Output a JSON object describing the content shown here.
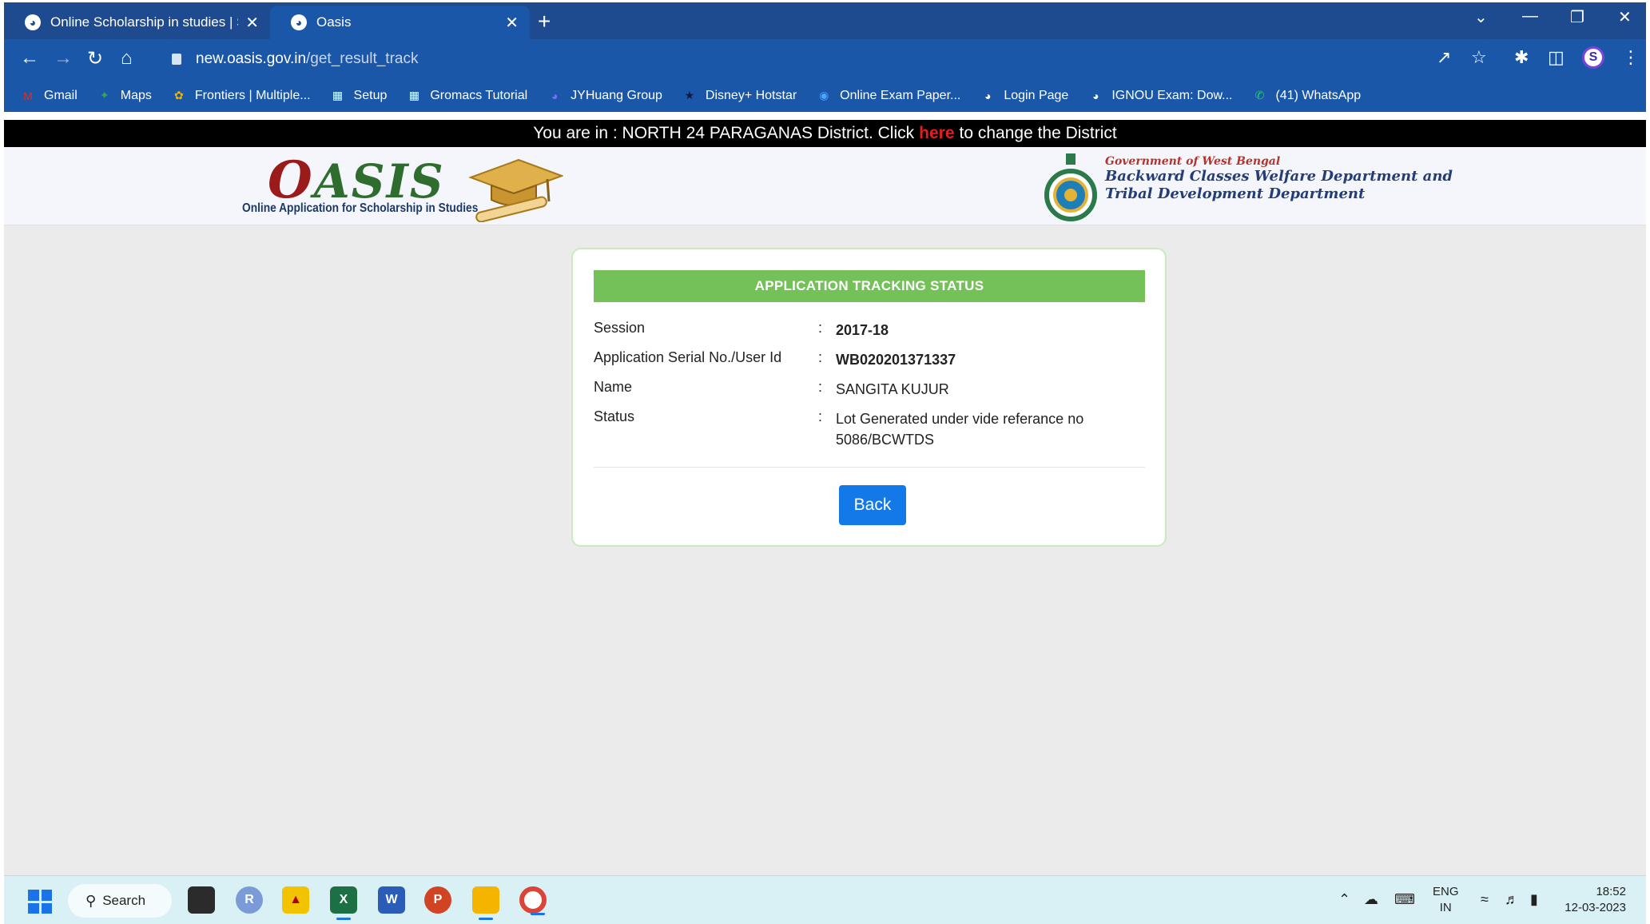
{
  "browser": {
    "tabs": [
      {
        "title": "Online Scholarship in studies | Sc"
      },
      {
        "title": "Oasis"
      }
    ],
    "url_host": "new.oasis.gov.in",
    "url_path": "/get_result_track",
    "bookmarks": [
      {
        "label": "Gmail",
        "icon": "gmail-icon",
        "color": "#d93025"
      },
      {
        "label": "Maps",
        "icon": "maps-icon",
        "color": "#34a853"
      },
      {
        "label": "Frontiers | Multiple...",
        "icon": "frontiers-icon",
        "color": "#f4b400"
      },
      {
        "label": "Setup",
        "icon": "grid-icon",
        "color": "#ffffff"
      },
      {
        "label": "Gromacs Tutorial",
        "icon": "grid-icon",
        "color": "#ffffff"
      },
      {
        "label": "JYHuang Group",
        "icon": "globe-icon",
        "color": "#7a6cff"
      },
      {
        "label": "Disney+ Hotstar",
        "icon": "hotstar-icon",
        "color": "#0f1a3c"
      },
      {
        "label": "Online Exam Paper...",
        "icon": "exam-icon",
        "color": "#4aa3ff"
      },
      {
        "label": "Login Page",
        "icon": "globe-icon",
        "color": "#ffffff"
      },
      {
        "label": "IGNOU Exam: Dow...",
        "icon": "globe-icon",
        "color": "#ffffff"
      },
      {
        "label": "(41) WhatsApp",
        "icon": "whatsapp-icon",
        "color": "#25d366"
      }
    ]
  },
  "site": {
    "district_prefix": "You are in : NORTH 24 PARAGANAS District. Click",
    "district_link": "here",
    "district_suffix": "to change the District",
    "logo_word": "ASIS",
    "logo_o": "O",
    "logo_subtitle": "Online Application for Scholarship in Studies",
    "gov_line": "Government of West Bengal",
    "dept_line1": "Backward Classes Welfare Department and",
    "dept_line2": "Tribal Development Department"
  },
  "card": {
    "heading": "APPLICATION TRACKING STATUS",
    "rows": [
      {
        "label": "Session",
        "colon": ":",
        "value": "2017-18"
      },
      {
        "label": "Application Serial No./User Id",
        "colon": ":",
        "value": "WB020201371337"
      },
      {
        "label": "Name",
        "colon": ":",
        "value": "SANGITA KUJUR"
      },
      {
        "label": "Status",
        "colon": ":",
        "value": "Lot Generated under vide referance no 5086/BCWTDS"
      }
    ],
    "back_label": "Back"
  },
  "taskbar": {
    "search_label": "Search",
    "lang_top": "ENG",
    "lang_bottom": "IN",
    "time": "18:52",
    "date": "12-03-2023"
  },
  "colors": {
    "tabstrip": "#1e4b8f",
    "toolbar": "#1a57a8",
    "card_header": "#74c15a",
    "back_button": "#1379e8",
    "district_link": "#e21f1f"
  }
}
